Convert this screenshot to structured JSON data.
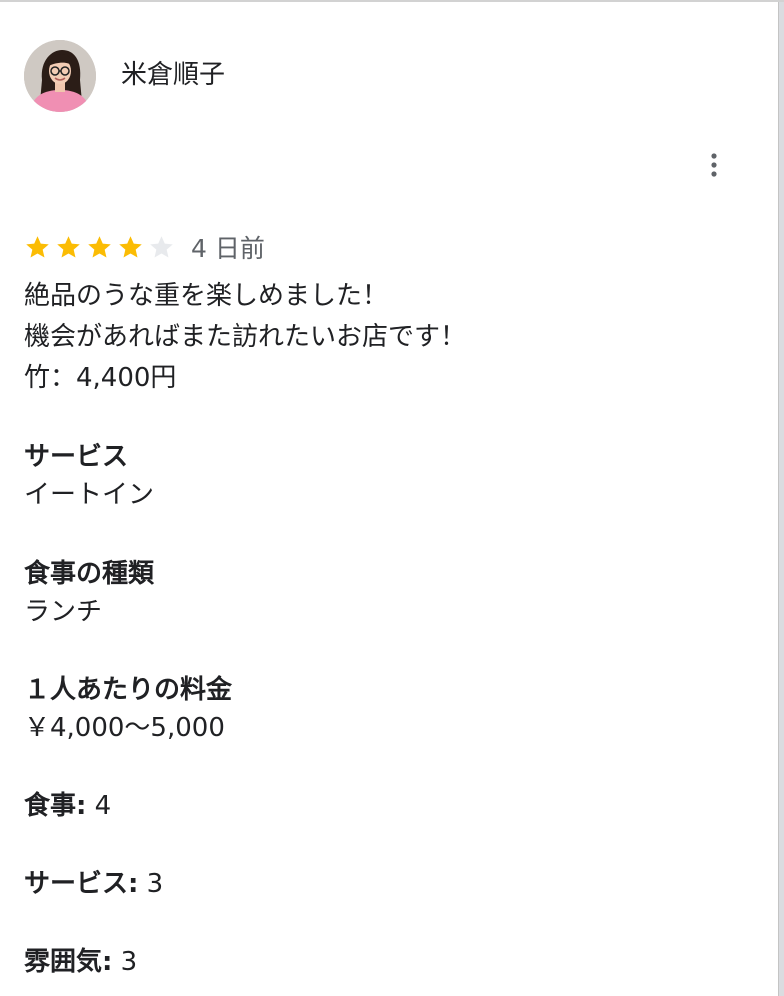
{
  "review": {
    "author_name": "米倉順子",
    "rating": 4,
    "rating_max": 5,
    "date": "4 日前",
    "text_lines": [
      "絶品のうな重を楽しめました！",
      "機会があればまた訪れたいお店です！",
      "竹：4,400円"
    ],
    "attributes": [
      {
        "label": "サービス",
        "value": "イートイン"
      },
      {
        "label": "食事の種類",
        "value": "ランチ"
      },
      {
        "label": "１人あたりの料金",
        "value": "￥4,000～5,000"
      }
    ],
    "scores": [
      {
        "label": "食事:",
        "value": "4"
      },
      {
        "label": "サービス:",
        "value": "3"
      },
      {
        "label": "雰囲気:",
        "value": "3"
      }
    ]
  },
  "icons": {
    "more": "more-vert-icon",
    "star_filled": "star-icon",
    "star_empty": "star-outline-icon"
  },
  "colors": {
    "star_filled": "#fbbc04",
    "star_empty": "#e8eaed",
    "text_primary": "#202124",
    "text_secondary": "#5f6368"
  }
}
